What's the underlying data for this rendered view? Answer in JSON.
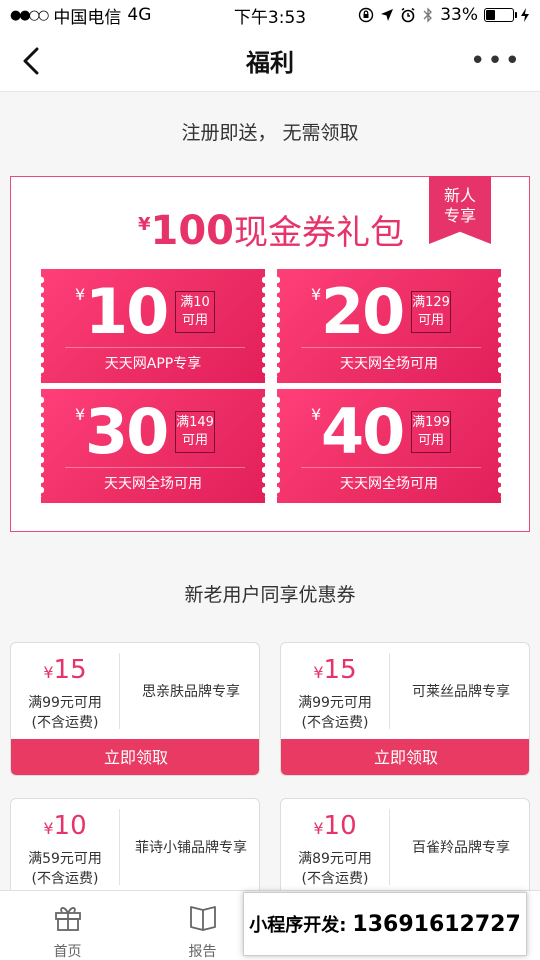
{
  "status_bar": {
    "signal": "●●○○",
    "carrier": "中国电信",
    "network": "4G",
    "time": "下午3:53",
    "battery_text": "33%",
    "battery_level": 0.33
  },
  "nav": {
    "title": "福利",
    "more": "•••"
  },
  "gift_section": {
    "heading": "注册即送， 无需领取",
    "yen": "¥",
    "amount": "100",
    "title_text": "现金券礼包",
    "badge": [
      "新人",
      "专享"
    ],
    "coupons": [
      {
        "yen": "¥",
        "amount": "10",
        "cond": [
          "满10",
          "可用"
        ],
        "desc": "天天网APP专享"
      },
      {
        "yen": "¥",
        "amount": "20",
        "cond": [
          "满129",
          "可用"
        ],
        "desc": "天天网全场可用"
      },
      {
        "yen": "¥",
        "amount": "30",
        "cond": [
          "满149",
          "可用"
        ],
        "desc": "天天网全场可用"
      },
      {
        "yen": "¥",
        "amount": "40",
        "cond": [
          "满199",
          "可用"
        ],
        "desc": "天天网全场可用"
      }
    ]
  },
  "shared_section": {
    "heading": "新老用户同享优惠券",
    "coupons": [
      {
        "yen": "¥",
        "amount": "15",
        "cond": "满99元可用",
        "note": "(不含运费)",
        "brand": "思亲肤品牌专享",
        "button": "立即领取"
      },
      {
        "yen": "¥",
        "amount": "15",
        "cond": "满99元可用",
        "note": "(不含运费)",
        "brand": "可莱丝品牌专享",
        "button": "立即领取"
      },
      {
        "yen": "¥",
        "amount": "10",
        "cond": "满59元可用",
        "note": "(不含运费)",
        "brand": "菲诗小铺品牌专享",
        "button": ""
      },
      {
        "yen": "¥",
        "amount": "10",
        "cond": "满89元可用",
        "note": "(不含运费)",
        "brand": "百雀羚品牌专享",
        "button": ""
      }
    ]
  },
  "tabs": [
    {
      "label": "首页",
      "icon": "gift-icon"
    },
    {
      "label": "报告",
      "icon": "book-icon"
    }
  ],
  "dev_banner": {
    "label": "小程序开发:",
    "phone": "13691612727"
  },
  "colors": {
    "accent": "#e6336a",
    "button": "#e83a62"
  }
}
